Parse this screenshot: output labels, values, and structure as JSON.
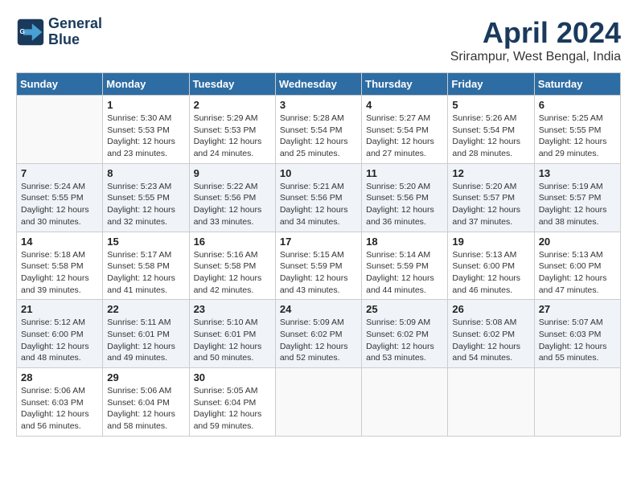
{
  "header": {
    "logo_line1": "General",
    "logo_line2": "Blue",
    "month_title": "April 2024",
    "location": "Srirampur, West Bengal, India"
  },
  "weekdays": [
    "Sunday",
    "Monday",
    "Tuesday",
    "Wednesday",
    "Thursday",
    "Friday",
    "Saturday"
  ],
  "weeks": [
    {
      "shaded": false,
      "days": [
        {
          "number": "",
          "info": ""
        },
        {
          "number": "1",
          "info": "Sunrise: 5:30 AM\nSunset: 5:53 PM\nDaylight: 12 hours\nand 23 minutes."
        },
        {
          "number": "2",
          "info": "Sunrise: 5:29 AM\nSunset: 5:53 PM\nDaylight: 12 hours\nand 24 minutes."
        },
        {
          "number": "3",
          "info": "Sunrise: 5:28 AM\nSunset: 5:54 PM\nDaylight: 12 hours\nand 25 minutes."
        },
        {
          "number": "4",
          "info": "Sunrise: 5:27 AM\nSunset: 5:54 PM\nDaylight: 12 hours\nand 27 minutes."
        },
        {
          "number": "5",
          "info": "Sunrise: 5:26 AM\nSunset: 5:54 PM\nDaylight: 12 hours\nand 28 minutes."
        },
        {
          "number": "6",
          "info": "Sunrise: 5:25 AM\nSunset: 5:55 PM\nDaylight: 12 hours\nand 29 minutes."
        }
      ]
    },
    {
      "shaded": true,
      "days": [
        {
          "number": "7",
          "info": "Sunrise: 5:24 AM\nSunset: 5:55 PM\nDaylight: 12 hours\nand 30 minutes."
        },
        {
          "number": "8",
          "info": "Sunrise: 5:23 AM\nSunset: 5:55 PM\nDaylight: 12 hours\nand 32 minutes."
        },
        {
          "number": "9",
          "info": "Sunrise: 5:22 AM\nSunset: 5:56 PM\nDaylight: 12 hours\nand 33 minutes."
        },
        {
          "number": "10",
          "info": "Sunrise: 5:21 AM\nSunset: 5:56 PM\nDaylight: 12 hours\nand 34 minutes."
        },
        {
          "number": "11",
          "info": "Sunrise: 5:20 AM\nSunset: 5:56 PM\nDaylight: 12 hours\nand 36 minutes."
        },
        {
          "number": "12",
          "info": "Sunrise: 5:20 AM\nSunset: 5:57 PM\nDaylight: 12 hours\nand 37 minutes."
        },
        {
          "number": "13",
          "info": "Sunrise: 5:19 AM\nSunset: 5:57 PM\nDaylight: 12 hours\nand 38 minutes."
        }
      ]
    },
    {
      "shaded": false,
      "days": [
        {
          "number": "14",
          "info": "Sunrise: 5:18 AM\nSunset: 5:58 PM\nDaylight: 12 hours\nand 39 minutes."
        },
        {
          "number": "15",
          "info": "Sunrise: 5:17 AM\nSunset: 5:58 PM\nDaylight: 12 hours\nand 41 minutes."
        },
        {
          "number": "16",
          "info": "Sunrise: 5:16 AM\nSunset: 5:58 PM\nDaylight: 12 hours\nand 42 minutes."
        },
        {
          "number": "17",
          "info": "Sunrise: 5:15 AM\nSunset: 5:59 PM\nDaylight: 12 hours\nand 43 minutes."
        },
        {
          "number": "18",
          "info": "Sunrise: 5:14 AM\nSunset: 5:59 PM\nDaylight: 12 hours\nand 44 minutes."
        },
        {
          "number": "19",
          "info": "Sunrise: 5:13 AM\nSunset: 6:00 PM\nDaylight: 12 hours\nand 46 minutes."
        },
        {
          "number": "20",
          "info": "Sunrise: 5:13 AM\nSunset: 6:00 PM\nDaylight: 12 hours\nand 47 minutes."
        }
      ]
    },
    {
      "shaded": true,
      "days": [
        {
          "number": "21",
          "info": "Sunrise: 5:12 AM\nSunset: 6:00 PM\nDaylight: 12 hours\nand 48 minutes."
        },
        {
          "number": "22",
          "info": "Sunrise: 5:11 AM\nSunset: 6:01 PM\nDaylight: 12 hours\nand 49 minutes."
        },
        {
          "number": "23",
          "info": "Sunrise: 5:10 AM\nSunset: 6:01 PM\nDaylight: 12 hours\nand 50 minutes."
        },
        {
          "number": "24",
          "info": "Sunrise: 5:09 AM\nSunset: 6:02 PM\nDaylight: 12 hours\nand 52 minutes."
        },
        {
          "number": "25",
          "info": "Sunrise: 5:09 AM\nSunset: 6:02 PM\nDaylight: 12 hours\nand 53 minutes."
        },
        {
          "number": "26",
          "info": "Sunrise: 5:08 AM\nSunset: 6:02 PM\nDaylight: 12 hours\nand 54 minutes."
        },
        {
          "number": "27",
          "info": "Sunrise: 5:07 AM\nSunset: 6:03 PM\nDaylight: 12 hours\nand 55 minutes."
        }
      ]
    },
    {
      "shaded": false,
      "days": [
        {
          "number": "28",
          "info": "Sunrise: 5:06 AM\nSunset: 6:03 PM\nDaylight: 12 hours\nand 56 minutes."
        },
        {
          "number": "29",
          "info": "Sunrise: 5:06 AM\nSunset: 6:04 PM\nDaylight: 12 hours\nand 58 minutes."
        },
        {
          "number": "30",
          "info": "Sunrise: 5:05 AM\nSunset: 6:04 PM\nDaylight: 12 hours\nand 59 minutes."
        },
        {
          "number": "",
          "info": ""
        },
        {
          "number": "",
          "info": ""
        },
        {
          "number": "",
          "info": ""
        },
        {
          "number": "",
          "info": ""
        }
      ]
    }
  ]
}
